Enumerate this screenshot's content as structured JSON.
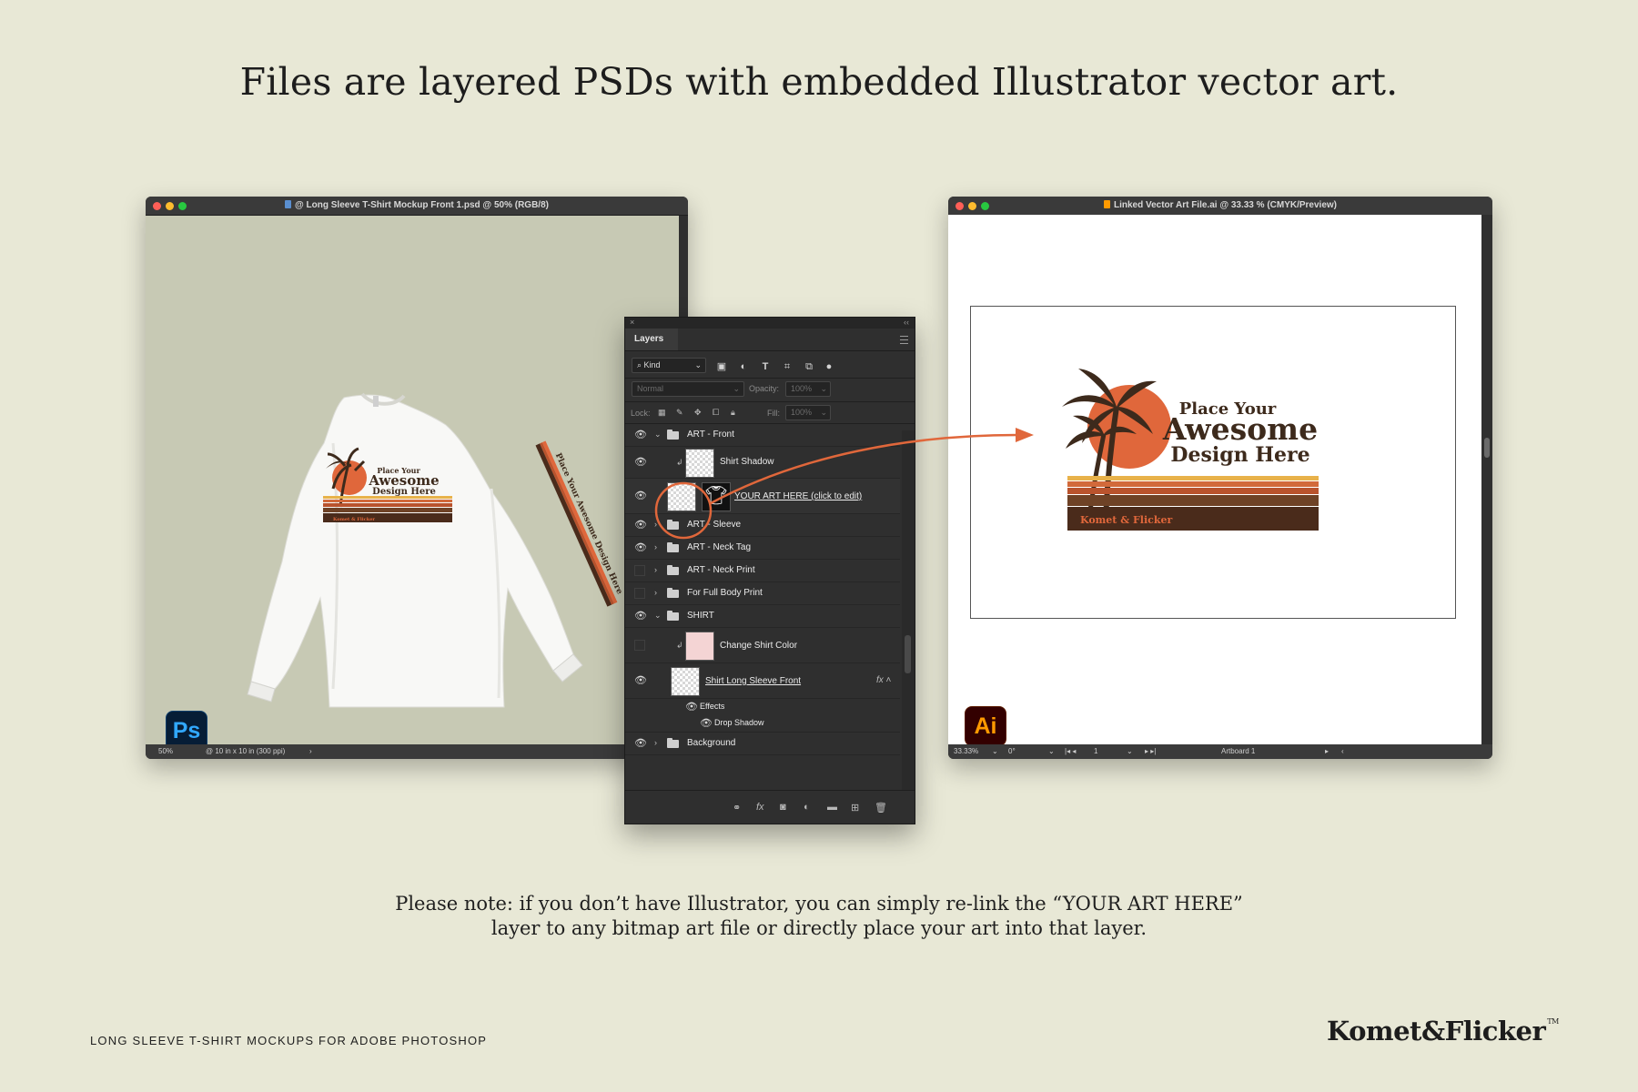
{
  "headline": "Files are layered PSDs with embedded Illustrator vector art.",
  "ps_window": {
    "title": "@ Long Sleeve T-Shirt Mockup Front 1.psd @ 50% (RGB/8)",
    "zoom": "50%",
    "doc_info": "@ 10 in x 10 in (300 ppi)",
    "badge": "Ps"
  },
  "ai_window": {
    "title": "Linked Vector Art File.ai @ 33.33 % (CMYK/Preview)",
    "zoom": "33.33%",
    "angle": "0°",
    "artboard_num": "1",
    "artboard_label": "Artboard 1",
    "badge": "Ai"
  },
  "design_art": {
    "line1": "Place Your",
    "line2": "Awesome",
    "line3": "Design Here",
    "banner": "Komet & Flicker",
    "sleeve_text": "Place Your Awesome Design Here",
    "colors": {
      "sun": "#e0673b",
      "palm": "#3d2a1c",
      "stripe1": "#e8b24a",
      "stripe2": "#d2693a",
      "stripe3": "#b9532d",
      "stripe4": "#6e4226",
      "banner": "#4a2b1b",
      "banner_text": "#e0673b"
    }
  },
  "layers_panel": {
    "tab": "Layers",
    "filter_kind": "Kind",
    "blend_mode": "Normal",
    "opacity_label": "Opacity:",
    "opacity_value": "100%",
    "lock_label": "Lock:",
    "fill_label": "Fill:",
    "fill_value": "100%",
    "layers": [
      {
        "name": "ART - Front",
        "type": "group",
        "expanded": true,
        "visible": true
      },
      {
        "name": "Shirt Shadow",
        "type": "layer",
        "visible": true
      },
      {
        "name": "YOUR ART HERE (click to edit)",
        "type": "smart",
        "visible": true
      },
      {
        "name": "ART - Sleeve",
        "type": "group",
        "visible": true
      },
      {
        "name": "ART - Neck Tag",
        "type": "group",
        "visible": true
      },
      {
        "name": "ART - Neck Print",
        "type": "group",
        "visible": false
      },
      {
        "name": "For Full Body Print",
        "type": "group",
        "visible": false
      },
      {
        "name": "SHIRT",
        "type": "group",
        "expanded": true,
        "visible": true
      },
      {
        "name": "Change Shirt Color",
        "type": "layer",
        "visible": false
      },
      {
        "name": "Shirt Long Sleeve Front",
        "type": "layer",
        "visible": true
      },
      {
        "name": "Effects",
        "type": "effect",
        "visible": true
      },
      {
        "name": "Drop Shadow",
        "type": "effect",
        "visible": true
      },
      {
        "name": "Background",
        "type": "group",
        "visible": true
      }
    ]
  },
  "note": {
    "line1": "Please note: if you don’t have Illustrator, you can simply re-link the “YOUR ART HERE”",
    "line2": "layer to any bitmap art file or directly place your art into that layer."
  },
  "footer": {
    "left": "LONG SLEEVE T-SHIRT MOCKUPS FOR ADOBE PHOTOSHOP",
    "brand": "Komet&Flicker",
    "tm": "TM"
  }
}
